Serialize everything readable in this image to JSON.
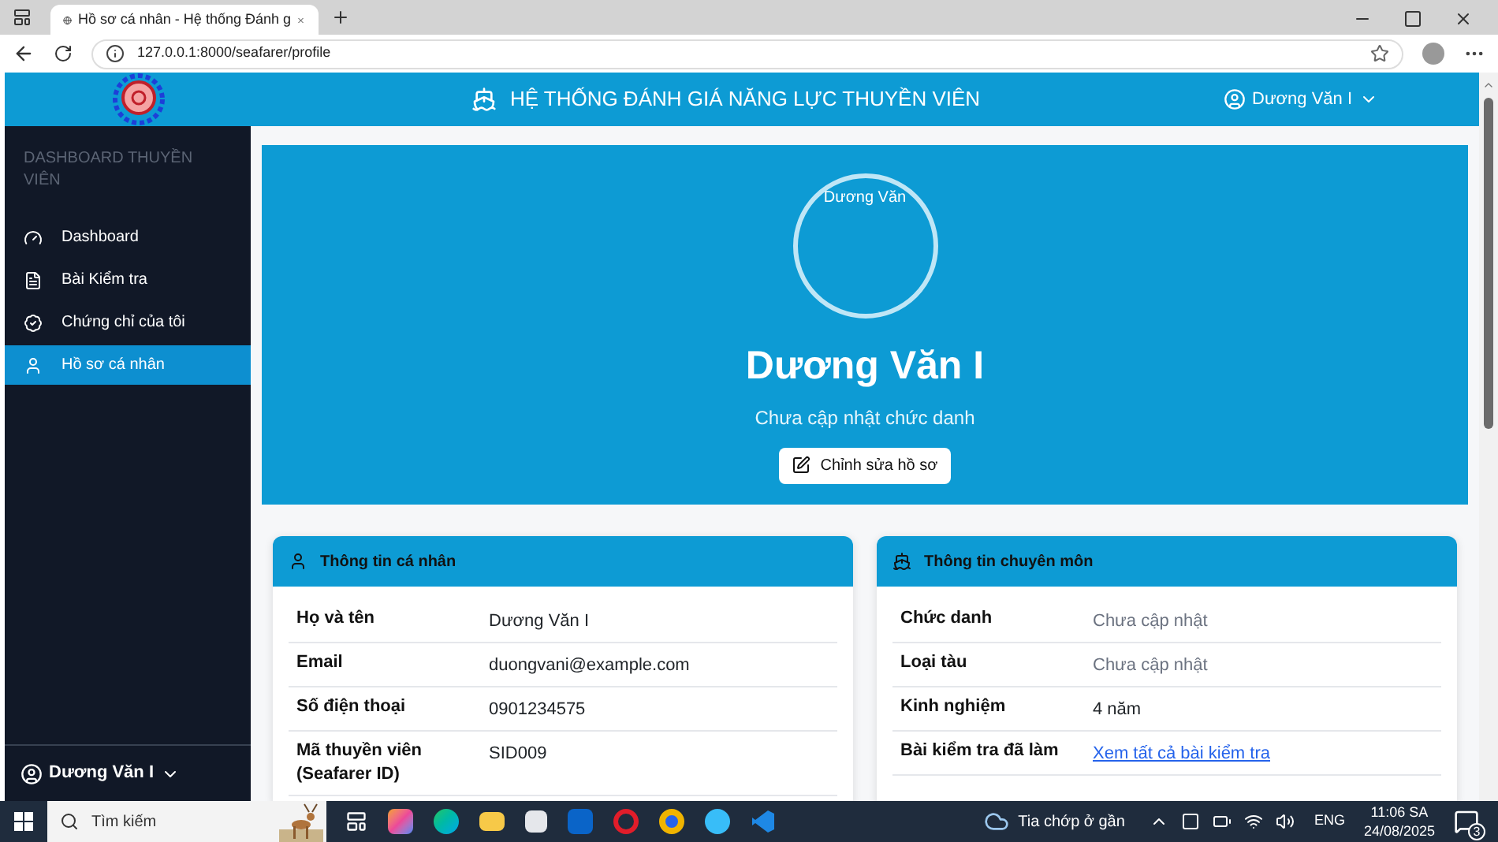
{
  "browser": {
    "tab_title": "Hồ sơ cá nhân - Hệ thống Đánh g",
    "url": "127.0.0.1:8000/seafarer/profile"
  },
  "header": {
    "title": "HỆ THỐNG ĐÁNH GIÁ NĂNG LỰC THUYỀN VIÊN",
    "user": "Dương Văn I"
  },
  "sidebar": {
    "heading": "DASHBOARD THUYỀN VIÊN",
    "items": [
      {
        "label": "Dashboard",
        "selected": false
      },
      {
        "label": "Bài Kiểm tra",
        "selected": false
      },
      {
        "label": "Chứng chỉ của tôi",
        "selected": false
      },
      {
        "label": "Hồ sơ cá nhân",
        "selected": true
      }
    ],
    "user": "Dương Văn I"
  },
  "profile": {
    "avatar_alt": "Dương Văn",
    "name": "Dương Văn I",
    "position": "Chưa cập nhật chức danh",
    "edit_button": "Chỉnh sửa hồ sơ"
  },
  "cards": [
    {
      "title": "Thông tin cá nhân",
      "rows": [
        {
          "label": "Họ và tên",
          "value": "Dương Văn I",
          "kind": "text"
        },
        {
          "label": "Email",
          "value": "duongvani@example.com",
          "kind": "text"
        },
        {
          "label": "Số điện thoại",
          "value": "0901234575",
          "kind": "text"
        },
        {
          "label": "Mã thuyền viên (Seafarer ID)",
          "value": "SID009",
          "kind": "text"
        }
      ]
    },
    {
      "title": "Thông tin chuyên môn",
      "rows": [
        {
          "label": "Chức danh",
          "value": "Chưa cập nhật",
          "kind": "muted"
        },
        {
          "label": "Loại tàu",
          "value": "Chưa cập nhật",
          "kind": "muted"
        },
        {
          "label": "Kinh nghiệm",
          "value": "4 năm",
          "kind": "text"
        },
        {
          "label": "Bài kiểm tra đã làm",
          "value": "Xem tất cả bài kiểm tra",
          "kind": "link"
        }
      ]
    }
  ],
  "taskbar": {
    "search": "Tìm kiếm",
    "weather": "Tia chớp ở gần",
    "language": "ENG",
    "time": "11:06 SA",
    "date": "24/08/2025",
    "notifications": "3"
  }
}
